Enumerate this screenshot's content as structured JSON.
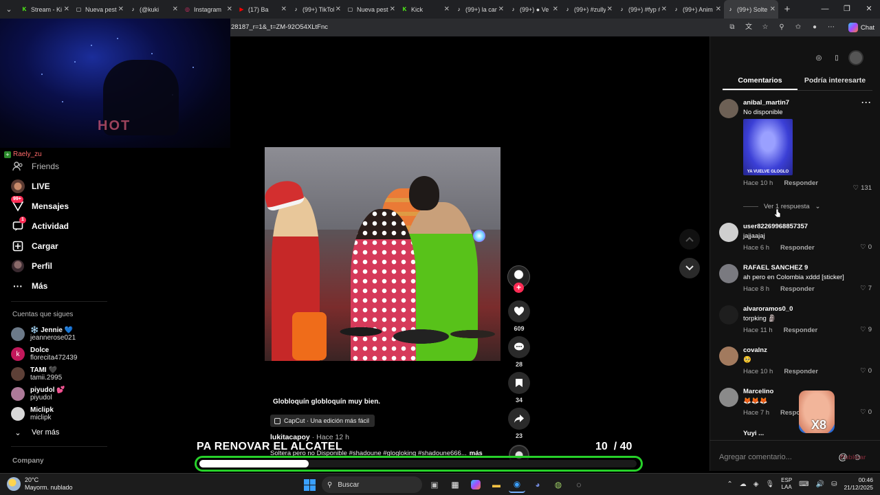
{
  "browser": {
    "tabs": [
      {
        "label": "Stream - Ki",
        "icon": "K",
        "color": "#53fc18"
      },
      {
        "label": "Nueva pesta",
        "icon": "▢",
        "color": "#dddddd"
      },
      {
        "label": "(@kuki",
        "icon": "♪",
        "color": "#ffffff"
      },
      {
        "label": "Instagram",
        "icon": "◎",
        "color": "#e1306c"
      },
      {
        "label": "(17) Ba",
        "icon": "▶",
        "color": "#ff0000"
      },
      {
        "label": "(99+) TikTok",
        "icon": "♪",
        "color": "#ffffff"
      },
      {
        "label": "Nueva pesta",
        "icon": "▢",
        "color": "#dddddd"
      },
      {
        "label": "Kick",
        "icon": "K",
        "color": "#53fc18"
      },
      {
        "label": "(99+) la can",
        "icon": "♪",
        "color": "#ffffff"
      },
      {
        "label": "(99+) ● Ve",
        "icon": "♪",
        "color": "#ffffff"
      },
      {
        "label": "(99+) #zully",
        "icon": "♪",
        "color": "#ffffff"
      },
      {
        "label": "(99+) #fyp #",
        "icon": "♪",
        "color": "#ffffff"
      },
      {
        "label": "(99+) Anim",
        "icon": "♪",
        "color": "#ffffff"
      },
      {
        "label": "(99+) Solte",
        "icon": "♪",
        "color": "#ffffff",
        "active": true
      }
    ],
    "url": "28187_r=1&_t=ZM-92O54XLtFnc",
    "chat_label": "Chat"
  },
  "webcam": {
    "neon_text": "HOT"
  },
  "sidebar": {
    "streamer_name": "Raely_zu",
    "nav": [
      {
        "label": "Friends",
        "icon": "friends-icon"
      },
      {
        "label": "LIVE",
        "icon": "live-icon"
      },
      {
        "label": "Mensajes",
        "icon": "messages-icon",
        "badge": "99+"
      },
      {
        "label": "Actividad",
        "icon": "activity-icon",
        "badge": "1"
      },
      {
        "label": "Cargar",
        "icon": "upload-icon"
      },
      {
        "label": "Perfil",
        "icon": "profile-icon"
      },
      {
        "label": "Más",
        "icon": "more-icon"
      }
    ],
    "following_title": "Cuentas que sigues",
    "following": [
      {
        "name": "❄️ Jennie 💙",
        "user": "jeannerose021",
        "color": "#6c7a89"
      },
      {
        "name": "Dolce",
        "user": "florecita472439",
        "color": "#c2185b",
        "initial": "k"
      },
      {
        "name": "TAMI 🖤",
        "user": "tamii.2995",
        "color": "#5d4037"
      },
      {
        "name": "piyudol 💕",
        "user": "piyudol",
        "color": "#ad7a99"
      },
      {
        "name": "Miclipk",
        "user": "miclipk",
        "color": "#d8d8d8"
      }
    ],
    "see_more": "Ver más",
    "company": "Company"
  },
  "video": {
    "caption": "Globloquín globloquín muy bien.",
    "capcut": "CapCut · Una edición más fácil",
    "author": "lukitacapoy",
    "posted": "Hace 12 h",
    "description": "Soltera pero no Disponible #shadoune #glogloking #shadoune666...",
    "more": "más",
    "likes": "609",
    "comments": "28",
    "saves": "34",
    "shares": "23"
  },
  "goal": {
    "text": "PA RENOVAR EL ALCATEL",
    "current": "10",
    "total": "/ 40",
    "progress": 0.25,
    "border_color": "#27d12a"
  },
  "comments_panel": {
    "tabs": [
      "Comentarios",
      "Podría interesarte"
    ],
    "comments": [
      {
        "user": "anibal_martin7",
        "text": "No disponible",
        "time": "Hace 10 h",
        "reply": "Responder",
        "likes": "131",
        "avatar": "#6d6055",
        "gif_caption": "YA VUELVE GLOGLO"
      },
      {
        "user": "user82269968857357",
        "text": "jajjaajaj",
        "time": "Hace 6 h",
        "reply": "Responder",
        "likes": "0",
        "avatar": "#cfcfcf"
      },
      {
        "user": "RAFAEL SANCHEZ 9",
        "text": "ah pero en Colombia xddd [sticker]",
        "time": "Hace 8 h",
        "reply": "Responder",
        "likes": "7",
        "avatar": "#7a7a80"
      },
      {
        "user": "alvaroramos0_0",
        "text": "torpking 🗿",
        "time": "Hace 11 h",
        "reply": "Responder",
        "likes": "9",
        "avatar": "#1e1e1e"
      },
      {
        "user": "covalnz",
        "text": "🥺",
        "time": "Hace 10 h",
        "reply": "Responder",
        "likes": "0",
        "avatar": "#a27a5e"
      },
      {
        "user": "Marcelino",
        "text": "🦊🦊🦊",
        "time": "Hace 7 h",
        "reply": "Respon",
        "likes": "0",
        "avatar": "#8a8a8a"
      }
    ],
    "view_replies": "Ver 1 respuesta",
    "next_user": "Yuyi ...",
    "sticker_text": "X8",
    "input_placeholder": "Agregar comentario...",
    "publish": "Publicar"
  },
  "taskbar": {
    "temperature": "20°C",
    "weather": "Mayorm. nublado",
    "search": "Buscar",
    "lang_1": "ESP",
    "lang_2": "LAA",
    "time": "00:46",
    "date": "21/12/2025"
  }
}
